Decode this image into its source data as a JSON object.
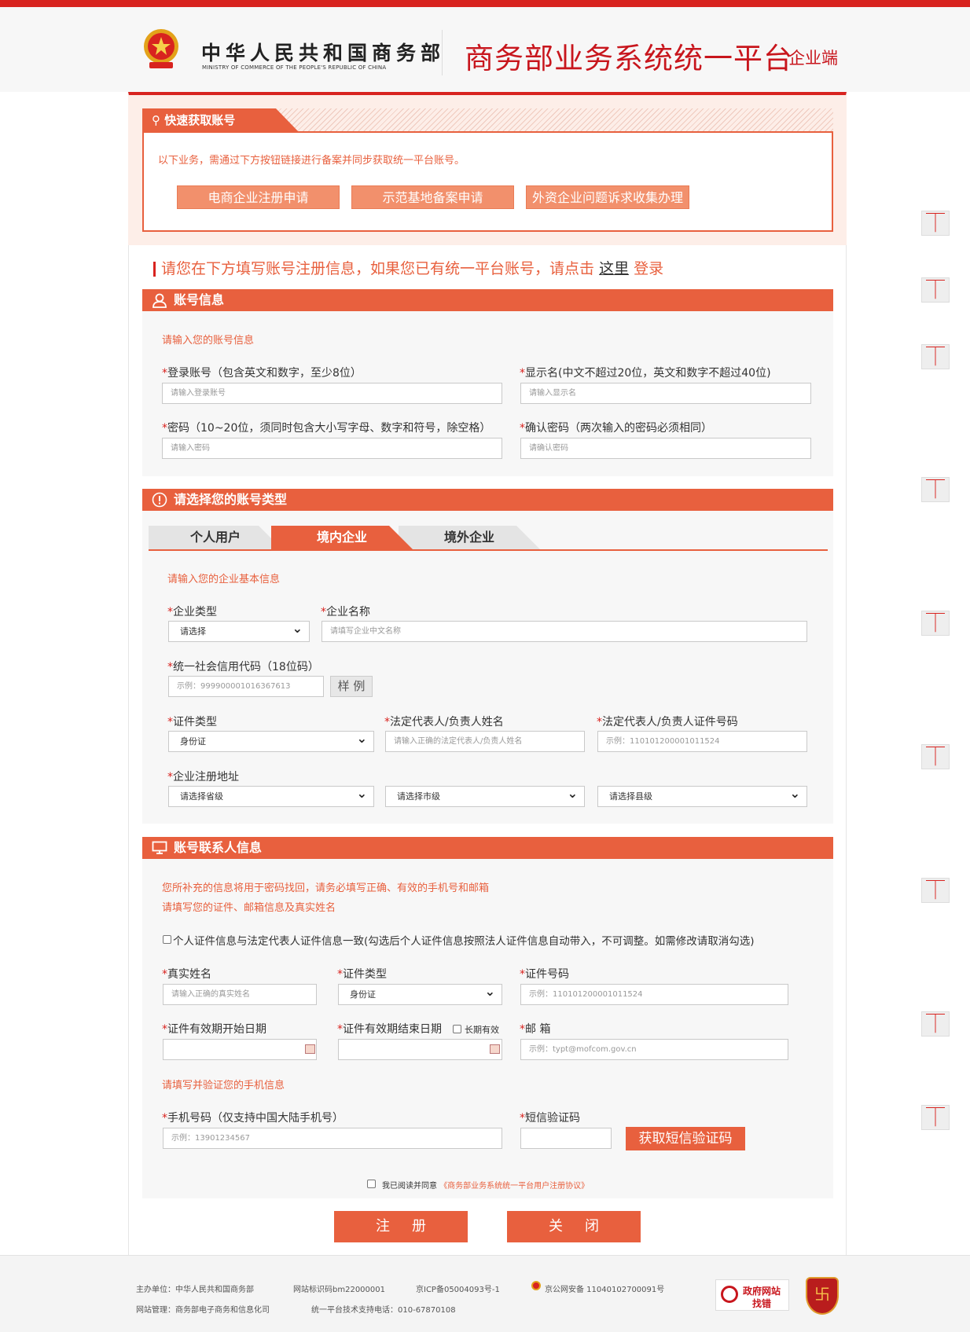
{
  "header": {
    "org_cn": "中华人民共和国商务部",
    "org_en": "MINISTRY OF COMMERCE OF THE PEOPLE'S REPUBLIC OF CHINA",
    "platform": "商务部业务系统统一平台",
    "platform_sub": "企业端"
  },
  "quick": {
    "title": "快速获取账号",
    "desc": "以下业务，需通过下方按钮链接进行备案并同步获取统一平台账号。",
    "buttons": [
      "电商企业注册申请",
      "示范基地备案申请",
      "外资企业问题诉求收集办理"
    ]
  },
  "prompt": {
    "text": "请您在下方填写账号注册信息，如果您已有统一平台账号，请点击",
    "link": "这里",
    "suffix": "登录"
  },
  "account": {
    "title": "账号信息",
    "hint": "请输入您的账号信息",
    "login_label": "登录账号（包含英文和数字，至少8位）",
    "login_ph": "请输入登录账号",
    "display_label": "显示名(中文不超过20位，英文和数字不超过40位)",
    "display_ph": "请输入显示名",
    "pwd_label": "密码（10~20位，须同时包含大小写字母、数字和符号，除空格）",
    "pwd_ph": "请输入密码",
    "confirm_label": "确认密码（两次输入的密码必须相同）",
    "confirm_ph": "请确认密码"
  },
  "type": {
    "title": "请选择您的账号类型",
    "tabs": [
      "个人用户",
      "境内企业",
      "境外企业"
    ],
    "hint": "请输入您的企业基本信息",
    "company_type_label": "企业类型",
    "company_type_value": "请选择",
    "company_name_label": "企业名称",
    "company_name_ph": "请填写企业中文名称",
    "credit_label": "统一社会信用代码（18位码）",
    "credit_ph": "示例：999900001016367613",
    "sample_btn": "样 例",
    "cert_type_label": "证件类型",
    "cert_type_value": "身份证",
    "legal_name_label": "法定代表人/负责人姓名",
    "legal_name_ph": "请输入正确的法定代表人/负责人姓名",
    "legal_id_label": "法定代表人/负责人证件号码",
    "legal_id_ph": "示例：110101200001011524",
    "address_label": "企业注册地址",
    "province": "请选择省级",
    "city": "请选择市级",
    "county": "请选择县级"
  },
  "contact": {
    "title": "账号联系人信息",
    "hint1": "您所补充的信息将用于密码找回，请务必填写正确、有效的手机号和邮箱",
    "hint2": "请填写您的证件、邮箱信息及真实姓名",
    "same_check": "个人证件信息与法定代表人证件信息一致(勾选后个人证件信息按照法人证件信息自动带入，不可调整。如需修改请取消勾选)",
    "realname_label": "真实姓名",
    "realname_ph": "请输入正确的真实姓名",
    "cert_type_label": "证件类型",
    "cert_type_value": "身份证",
    "cert_no_label": "证件号码",
    "cert_no_ph": "示例：110101200001011524",
    "start_label": "证件有效期开始日期",
    "end_label": "证件有效期结束日期",
    "longterm": "长期有效",
    "email_label": "邮 箱",
    "email_ph": "示例：typt@mofcom.gov.cn",
    "phone_hint": "请填写并验证您的手机信息",
    "phone_label": "手机号码（仅支持中国大陆手机号）",
    "phone_ph": "示例：13901234567",
    "sms_label": "短信验证码",
    "sms_btn": "获取短信验证码",
    "agree_text": "我已阅读并同意",
    "agree_link": "《商务部业务系统统一平台用户注册协议》"
  },
  "actions": {
    "register": "注册",
    "close": "关闭"
  },
  "footer": {
    "line1_a": "主办单位：中华人民共和国商务部",
    "line1_b": "网站标识码bm22000001",
    "line1_c": "京ICP备05004093号-1",
    "line1_d": "京公网安备 11040102700091号",
    "line2_a": "网站管理：商务部电子商务和信息化司",
    "line2_b": "统一平台技术支持电话：010-67870108",
    "badge_1": "政府网站",
    "badge_2": "找错"
  },
  "colors": {
    "accent": "#e8603e",
    "brand_red": "#d8231f"
  }
}
